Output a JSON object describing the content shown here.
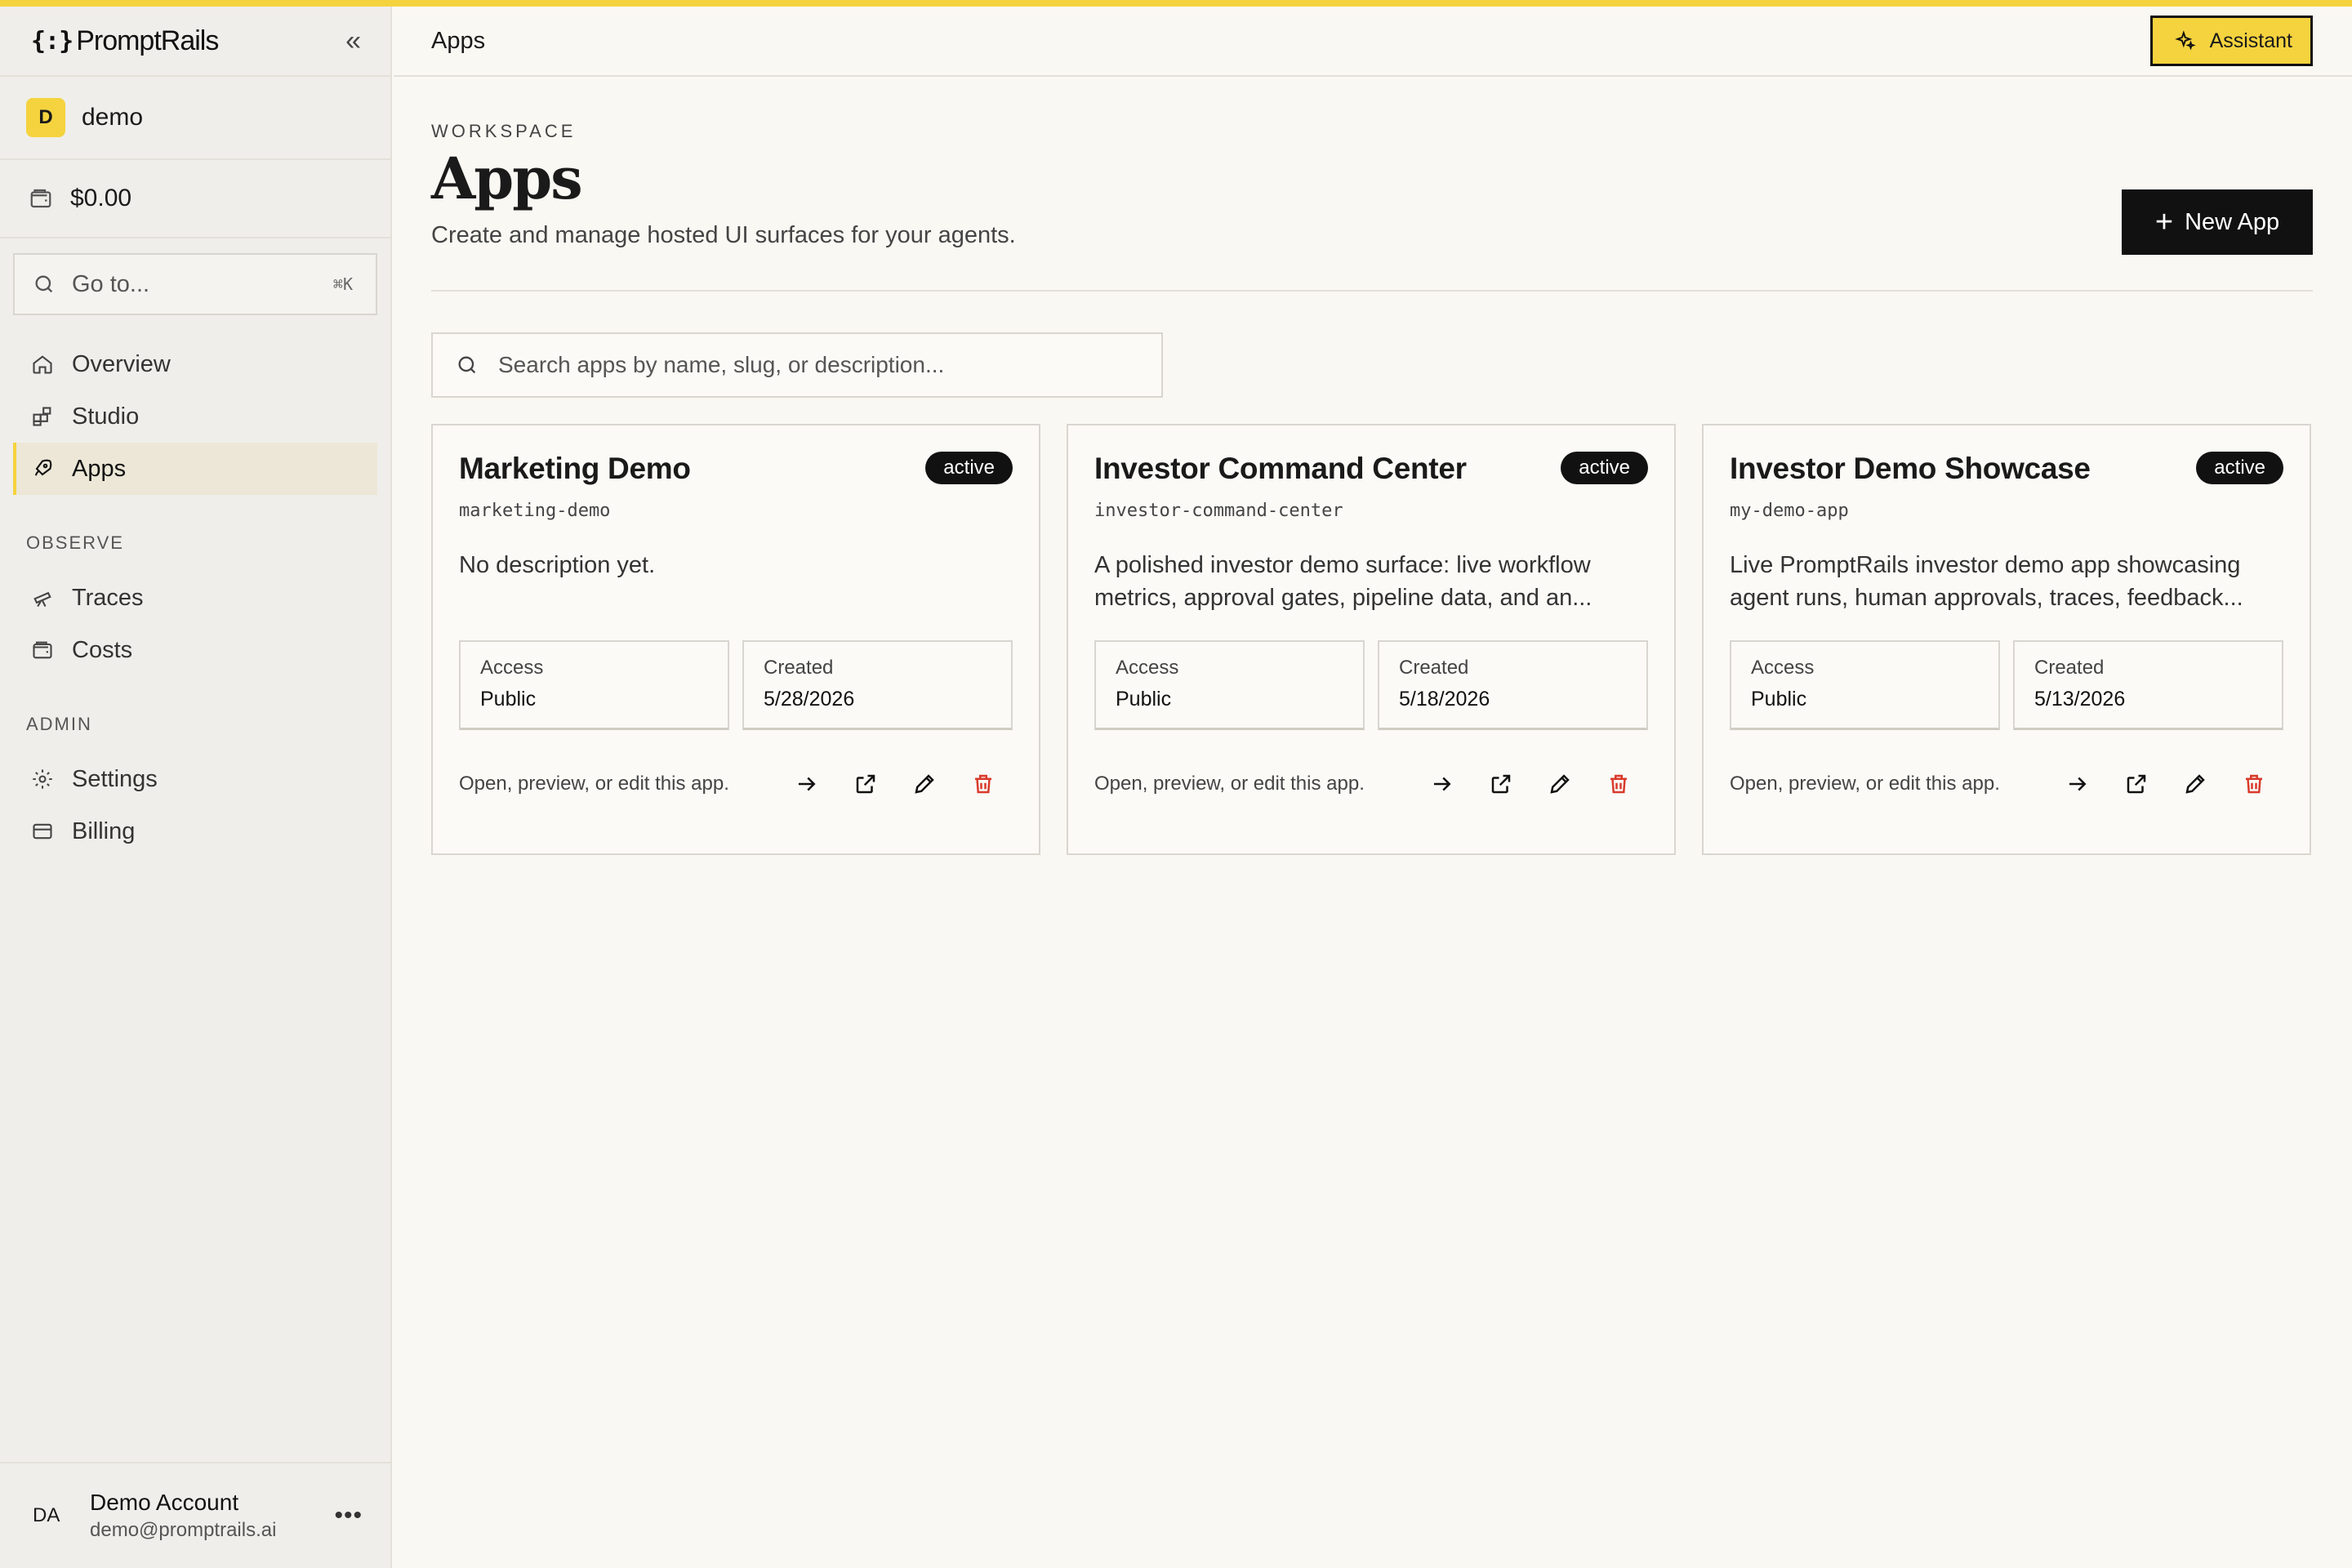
{
  "app": {
    "logo_text": "PromptRails",
    "logo_mark": "{:}",
    "accent": "#f5d33f"
  },
  "sidebar": {
    "workspace": {
      "avatar": "D",
      "name": "demo"
    },
    "balance": "$0.00",
    "goto": {
      "placeholder": "Go to...",
      "shortcut": "⌘K"
    },
    "items": [
      {
        "label": "Overview",
        "icon": "home-icon"
      },
      {
        "label": "Studio",
        "icon": "blocks-icon"
      },
      {
        "label": "Apps",
        "icon": "rocket-icon",
        "active": true
      }
    ],
    "observe_label": "OBSERVE",
    "observe_items": [
      {
        "label": "Traces",
        "icon": "telescope-icon"
      },
      {
        "label": "Costs",
        "icon": "wallet-icon"
      }
    ],
    "admin_label": "ADMIN",
    "admin_items": [
      {
        "label": "Settings",
        "icon": "gear-icon"
      },
      {
        "label": "Billing",
        "icon": "card-icon"
      }
    ],
    "user": {
      "initials": "DA",
      "name": "Demo Account",
      "email": "demo@promptrails.ai"
    }
  },
  "header": {
    "crumb": "Apps",
    "assistant_label": "Assistant"
  },
  "main": {
    "eyebrow": "WORKSPACE",
    "title": "Apps",
    "subtitle": "Create and manage hosted UI surfaces for your agents.",
    "new_app_label": "New App",
    "search_placeholder": "Search apps by name, slug, or description...",
    "cards": [
      {
        "name": "Marketing Demo",
        "status": "active",
        "slug": "marketing-demo",
        "description": "No description yet.",
        "access_label": "Access",
        "access": "Public",
        "created_label": "Created",
        "created": "5/28/2026",
        "footer": "Open, preview, or edit this app."
      },
      {
        "name": "Investor Command Center",
        "status": "active",
        "slug": "investor-command-center",
        "description": "A polished investor demo surface: live workflow metrics, approval gates, pipeline data, and an...",
        "access_label": "Access",
        "access": "Public",
        "created_label": "Created",
        "created": "5/18/2026",
        "footer": "Open, preview, or edit this app."
      },
      {
        "name": "Investor Demo Showcase",
        "status": "active",
        "slug": "my-demo-app",
        "description": "Live PromptRails investor demo app showcasing agent runs, human approvals, traces, feedback...",
        "access_label": "Access",
        "access": "Public",
        "created_label": "Created",
        "created": "5/13/2026",
        "footer": "Open, preview, or edit this app."
      }
    ]
  },
  "colors": {
    "delete": "#d93a2b",
    "dark": "#111111",
    "bg": "#f9f8f3"
  }
}
